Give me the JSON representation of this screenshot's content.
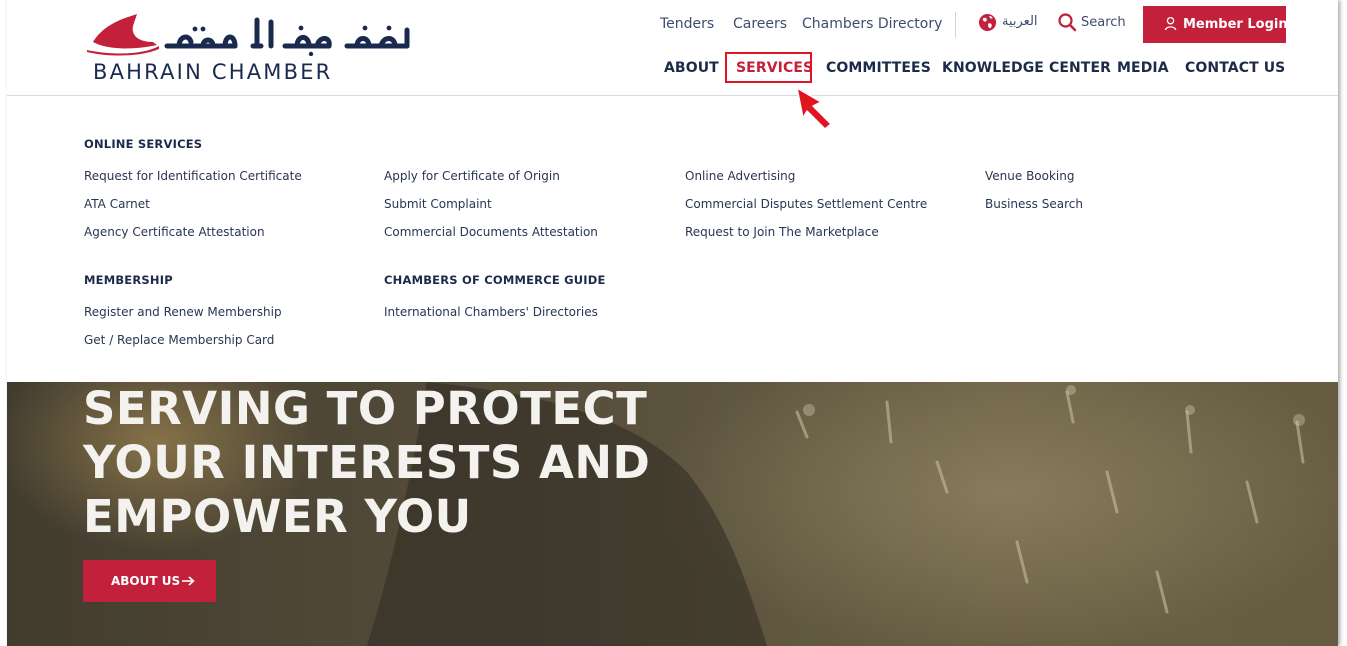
{
  "header": {
    "logo_ar": "غرفة البحرين",
    "logo_en": "BAHRAIN CHAMBER",
    "utility_links": [
      "Tenders",
      "Careers",
      "Chambers Directory"
    ],
    "language_link": "العربية",
    "search_label": "Search",
    "login_label": "Member Login",
    "nav": [
      "ABOUT",
      "SERVICES",
      "COMMITTEES",
      "KNOWLEDGE CENTER",
      "MEDIA",
      "CONTACT US"
    ],
    "active_nav": "SERVICES"
  },
  "menu": {
    "online_services": {
      "heading": "ONLINE SERVICES",
      "col1": [
        "Request for Identification Certificate",
        "ATA Carnet",
        "Agency Certificate Attestation"
      ],
      "col2": [
        "Apply for Certificate of Origin",
        "Submit Complaint",
        "Commercial Documents Attestation"
      ],
      "col3": [
        "Online Advertising",
        "Commercial Disputes Settlement Centre",
        "Request to Join The Marketplace"
      ],
      "col4": [
        "Venue Booking",
        "Business Search"
      ]
    },
    "membership": {
      "heading": "MEMBERSHIP",
      "items": [
        "Register and Renew Membership",
        "Get / Replace Membership Card"
      ]
    },
    "chambers_guide": {
      "heading": "CHAMBERS OF COMMERCE GUIDE",
      "items": [
        "International Chambers' Directories"
      ]
    }
  },
  "hero": {
    "title_lines": [
      "SERVING TO PROTECT",
      "YOUR INTERESTS AND",
      "EMPOWER YOU"
    ],
    "button_label": "ABOUT US"
  },
  "colors": {
    "brand_red": "#c2203b",
    "navy": "#1c2b4a",
    "highlight": "#e0151f"
  },
  "icons": [
    "globe-icon",
    "search-icon",
    "user-icon",
    "arrow-right-icon",
    "pointer-cursor-icon"
  ]
}
